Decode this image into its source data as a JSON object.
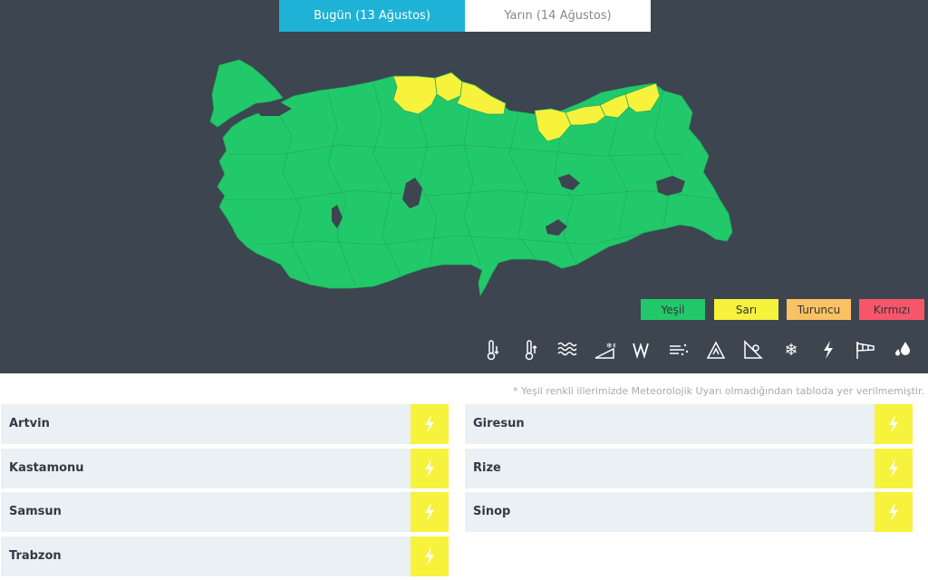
{
  "tabs": [
    {
      "label": "Bugün (13 Ağustos)",
      "active": true
    },
    {
      "label": "Yarın (14 Ağustos)",
      "active": false
    }
  ],
  "colors": {
    "background": "#3c4550",
    "tab_active": "#1eb2d6",
    "green": "#22c96a",
    "yellow": "#f7f23c",
    "orange": "#fbc264",
    "red": "#f7566a",
    "province_border": "#1fae5c"
  },
  "legend": [
    {
      "label": "Yeşil",
      "color": "#22c96a"
    },
    {
      "label": "Sarı",
      "color": "#f7f23c"
    },
    {
      "label": "Turuncu",
      "color": "#fbc264"
    },
    {
      "label": "Kırmızı",
      "color": "#f7566a"
    }
  ],
  "warning_types": [
    "cold-icon",
    "heat-icon",
    "fog-icon",
    "avalanche-icon",
    "wind-icon",
    "dust-icon",
    "landslide-icon",
    "slope-icon",
    "snow-icon",
    "thunderstorm-icon",
    "windsock-icon",
    "rain-icon"
  ],
  "note": "* Yeşil renkli illerimizde Meteorolojik Uyarı olmadığından tabloda yer verilmemiştir.",
  "provinces_left": [
    {
      "name": "Artvin",
      "level": "yellow",
      "hazard": "thunderstorm-icon"
    },
    {
      "name": "Kastamonu",
      "level": "yellow",
      "hazard": "thunderstorm-icon"
    },
    {
      "name": "Samsun",
      "level": "yellow",
      "hazard": "thunderstorm-icon"
    },
    {
      "name": "Trabzon",
      "level": "yellow",
      "hazard": "thunderstorm-icon"
    }
  ],
  "provinces_right": [
    {
      "name": "Giresun",
      "level": "yellow",
      "hazard": "thunderstorm-icon"
    },
    {
      "name": "Rize",
      "level": "yellow",
      "hazard": "thunderstorm-icon"
    },
    {
      "name": "Sinop",
      "level": "yellow",
      "hazard": "thunderstorm-icon"
    }
  ]
}
